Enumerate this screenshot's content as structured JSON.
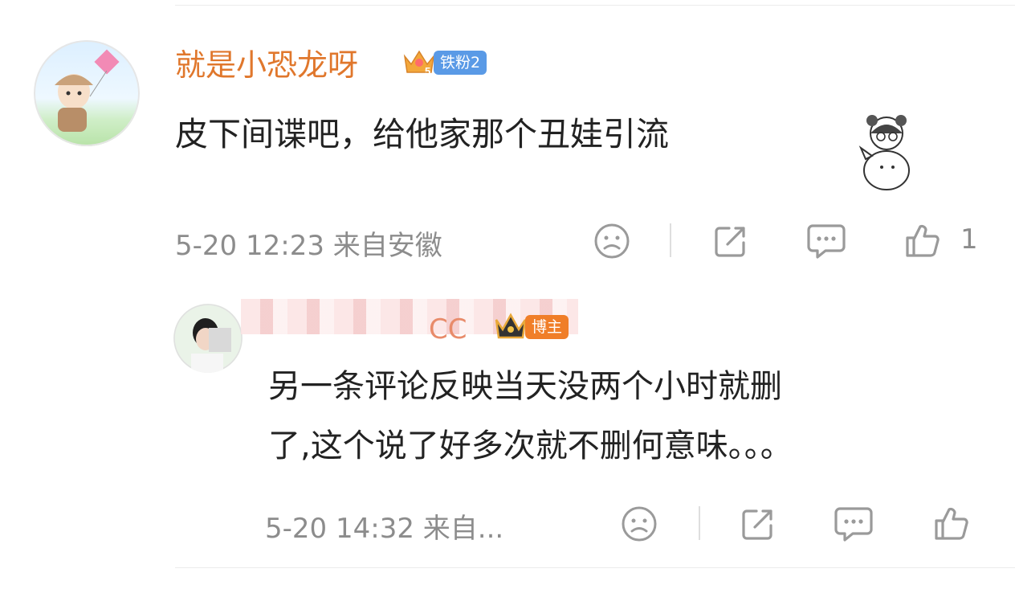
{
  "comments": [
    {
      "author": "就是小恐龙呀",
      "badge_label": "铁粉2",
      "badge_level": "5",
      "text": "皮下间谍吧，给他家那个丑娃引流",
      "meta": "5-20 12:23 来自安徽",
      "like_count": "1"
    }
  ],
  "reply": {
    "author_visible": "CC",
    "badge_label": "博主",
    "text_lines": [
      "另一条评论反映当天没两个小时就删",
      "了,这个说了好多次就不删何意味。。。"
    ],
    "meta": "5-20 14:32 来自..."
  },
  "colors": {
    "name": "#e0772c",
    "fan_badge": "#5a9ae6",
    "blogger_badge": "#f07e28",
    "meta": "#8c8c8c",
    "icon": "#9a9a9a"
  },
  "icons": [
    "sad-face-icon",
    "share-icon",
    "comment-icon",
    "thumbs-up-icon"
  ]
}
